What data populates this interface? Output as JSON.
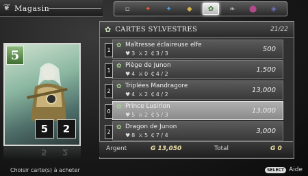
{
  "screen": {
    "title": "Magasin",
    "hint": "Choisir carte(s) à acheter"
  },
  "tabs": [
    {
      "icon": "neutral-icon",
      "glyph": "▫",
      "color": "#cfcfcf"
    },
    {
      "icon": "fire-icon",
      "glyph": "✦",
      "color": "#e05a3a"
    },
    {
      "icon": "water-icon",
      "glyph": "✦",
      "color": "#4aa0e0"
    },
    {
      "icon": "earth-icon",
      "glyph": "◆",
      "color": "#d6b24a"
    },
    {
      "icon": "forest-icon",
      "glyph": "✿",
      "color": "#3a7a30"
    },
    {
      "icon": "wind-icon",
      "glyph": "❧",
      "color": "#c0c0c0"
    },
    {
      "icon": "shadow-icon",
      "glyph": "⬤",
      "color": "#b04a8a"
    },
    {
      "icon": "light-icon",
      "glyph": "◈",
      "color": "#7070d0"
    }
  ],
  "card": {
    "cost": "5",
    "attack": "5",
    "defense": "2"
  },
  "list": {
    "category": "CARTES SYLVESTRES",
    "count": "21/22",
    "items": [
      {
        "qty": "1",
        "name": "Maîtresse éclaireuse elfe",
        "hp": "3",
        "atk": "2",
        "cost": "3 / 3",
        "price": "500"
      },
      {
        "qty": "1",
        "name": "Piège de Junon",
        "hp": "4",
        "atk": "0",
        "cost": "4 / 2",
        "price": "1,500"
      },
      {
        "qty": "2",
        "name": "Triplées Mandragore",
        "hp": "4",
        "atk": "2",
        "cost": "4 / 2",
        "price": "13,000"
      },
      {
        "qty": "0",
        "name": "Prince Lusirion",
        "hp": "5",
        "atk": "2",
        "cost": "5 / 3",
        "price": "13,000"
      },
      {
        "qty": "2",
        "name": "Dragon de Junon",
        "hp": "8",
        "atk": "5",
        "cost": "7 / 4",
        "price": "3,000"
      }
    ]
  },
  "footer": {
    "argent_label": "Argent",
    "argent_value": "G 13,050",
    "total_label": "Total",
    "total_value": "G 0"
  },
  "help": {
    "button": "SELECT",
    "label": "Aide"
  },
  "colors": {
    "accent": "#f0e2a8",
    "forest_green": "#a8d890",
    "selected_row": "#a0a0a0"
  }
}
